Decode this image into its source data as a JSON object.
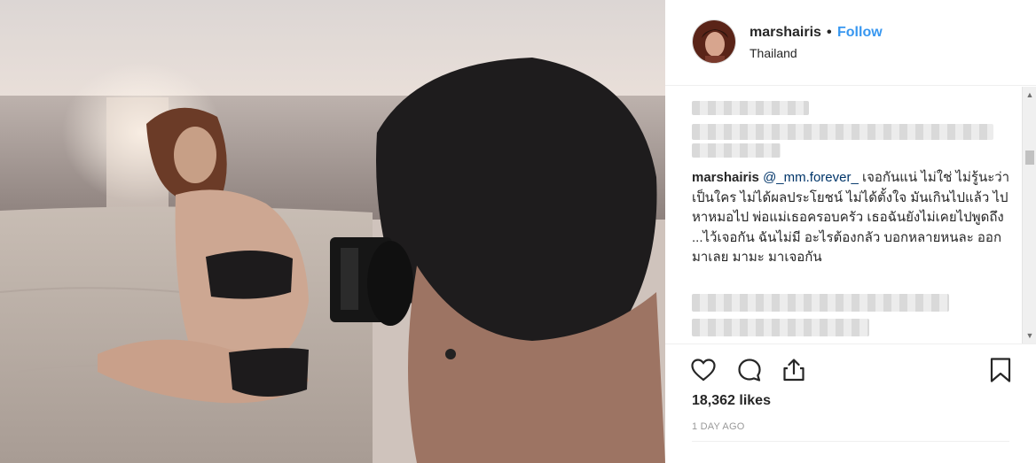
{
  "post": {
    "username": "marshairis",
    "separator": "•",
    "follow_label": "Follow",
    "location": "Thailand"
  },
  "caption": {
    "username": "marshairis",
    "mention": "@_mm.forever_",
    "text": " เจอกันแน่ ไม่ใช่ ไม่รู้นะว่าเป็นใคร ไม่ได้ผลประโยชน์ ไม่ได้ตั้งใจ มันเกินไปแล้ว ไปหาหมอไป พ่อแม่เธอครอบครัว เธอฉันยังไม่เคยไปพูดถึง ...ไว้เจอกัน ฉันไม่มี อะไรต้องกลัว บอกหลายหนละ ออกมาเลย มามะ มาเจอกัน"
  },
  "stats": {
    "likes": "18,362 likes",
    "time_ago": "1 DAY AGO"
  },
  "icons": {
    "like": "heart-icon",
    "comment": "comment-icon",
    "share": "share-icon",
    "save": "bookmark-icon"
  },
  "colors": {
    "link": "#3897f0",
    "text": "#262626",
    "muted": "#999999",
    "mention": "#003569"
  }
}
